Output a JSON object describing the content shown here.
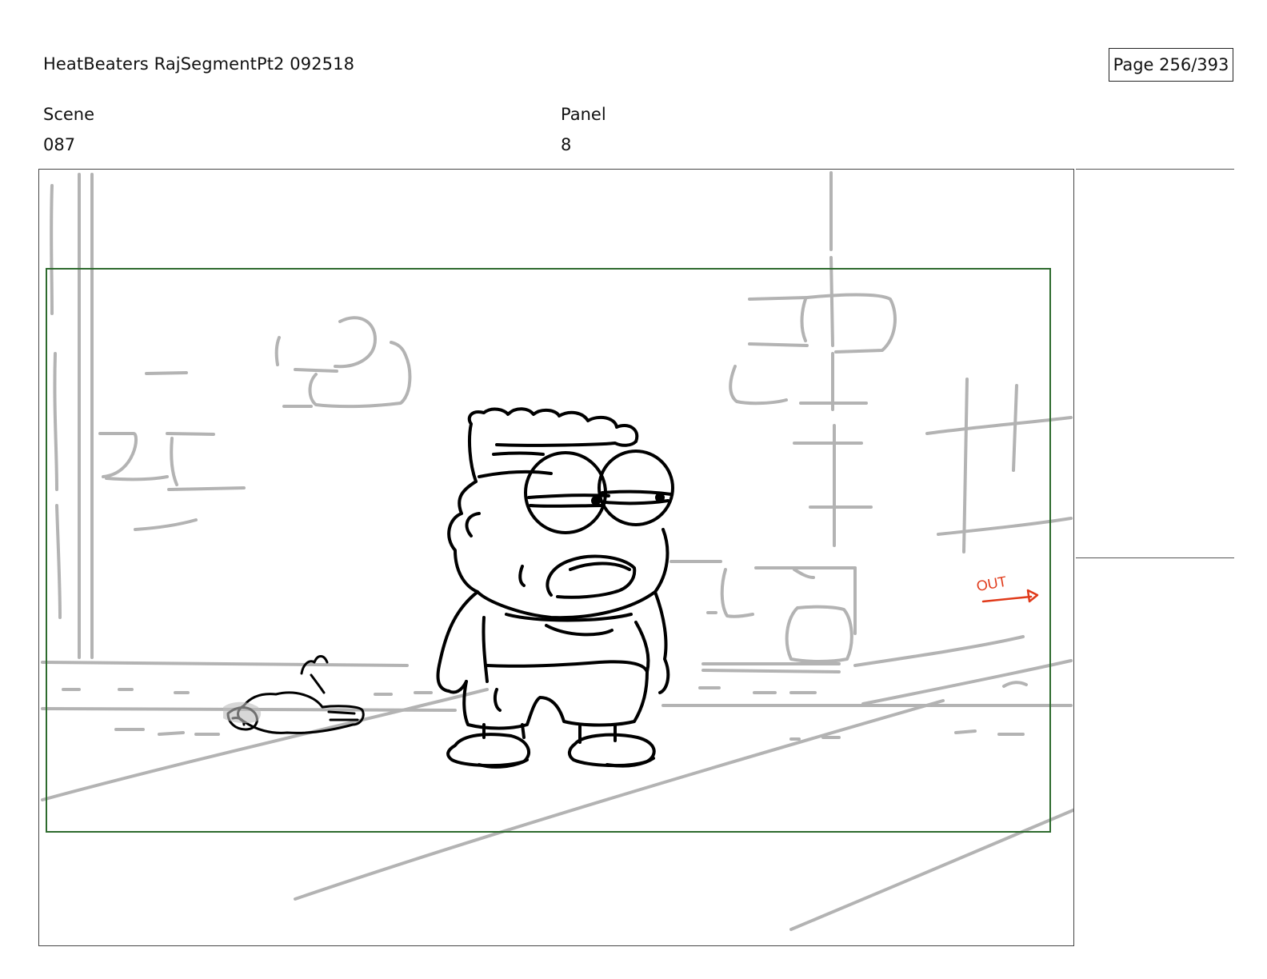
{
  "header": {
    "title": "HeatBeaters RajSegmentPt2 092518",
    "page": "Page 256/393"
  },
  "fields": {
    "scene_label": "Scene",
    "scene_value": "087",
    "panel_label": "Panel",
    "panel_value": "8"
  },
  "drawing": {
    "annotation": "OUT",
    "colors": {
      "background_sketch": "#b3b3b3",
      "character_ink": "#000000",
      "safe_frame": "#2e6b2e",
      "annotation": "#e03a1a"
    }
  }
}
